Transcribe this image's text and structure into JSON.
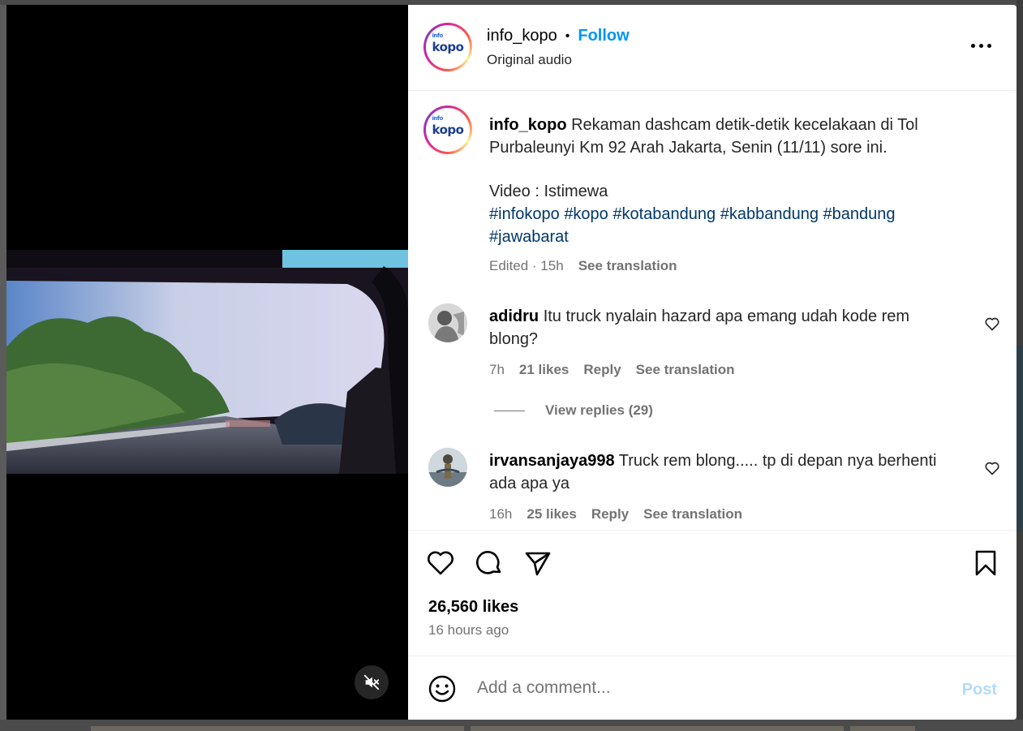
{
  "post": {
    "username": "info_kopo",
    "follow_label": "Follow",
    "separator": "•",
    "audio": "Original audio",
    "avatar_logo_small": "info",
    "avatar_logo_main": "kopo",
    "caption_text": "Rekaman dashcam detik-detik kecelakaan di Tol Purbaleunyi Km 92 Arah Jakarta, Senin (11/11) sore ini.",
    "caption_credit": "Video : Istimewa",
    "hashtags": [
      "#infokopo",
      "#kopo",
      "#kotabandung",
      "#kabbandung",
      "#bandung",
      "#jawabarat"
    ],
    "caption_meta": "Edited · 15h",
    "see_translation": "See translation",
    "likes": "26,560 likes",
    "time_ago": "16 hours ago"
  },
  "comments": [
    {
      "username": "adidru",
      "text": "Itu truck nyalain hazard apa emang udah kode rem blong?",
      "time": "7h",
      "likes": "21 likes",
      "reply": "Reply",
      "see_translation": "See translation",
      "view_replies": "View replies (29)"
    },
    {
      "username": "irvansanjaya998",
      "text": "Truck rem blong..... tp di depan nya berhenti ada apa ya",
      "time": "16h",
      "likes": "25 likes",
      "reply": "Reply",
      "see_translation": "See translation"
    }
  ],
  "comment_box": {
    "placeholder": "Add a comment...",
    "post_label": "Post"
  },
  "icons": {
    "more": "more-options-icon",
    "like": "heart-icon",
    "comment": "comment-icon",
    "share": "send-icon",
    "save": "bookmark-icon",
    "emoji": "emoji-icon",
    "mute": "muted-speaker-icon"
  },
  "colors": {
    "follow": "#0095f6",
    "hashtag": "#00376b",
    "muted_text": "#737373",
    "post_disabled": "#b3dbff"
  }
}
